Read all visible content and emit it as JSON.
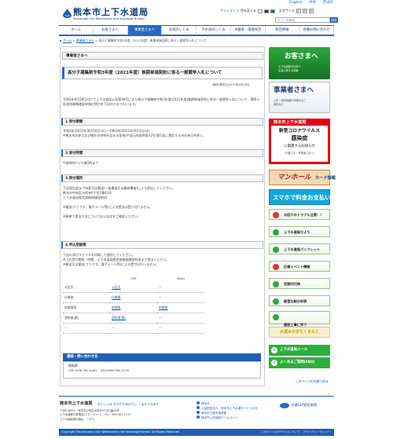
{
  "header": {
    "site_title": "熊本市上下水道局",
    "site_subtitle": "Kumamoto City Waterworks and Sewerage Bureau",
    "lang_links": [
      "English",
      "中文",
      "한국어"
    ],
    "sitemap_label": "サイトマップ",
    "color_label": "色を変える",
    "font_size_label": "文字サイズ",
    "font_size_buttons": [
      "小",
      "中",
      "大"
    ],
    "search_placeholder": "サイト内検索",
    "search_button": "検索",
    "accent_color": "#1f5eb5"
  },
  "nav": {
    "items": [
      "ホーム",
      "お客さまへ",
      "事業者さまへ",
      "水道のしくみ",
      "下水道のしくみ",
      "水循環・環境保全",
      "経営情報",
      "各種お問い合わせ"
    ],
    "active_index": 2
  },
  "breadcrumb": [
    "ホーム",
    "事業者さまへ",
    "高分子凝集剤令和3年度（2021年度）後期単価契約に係る一般競争入札について"
  ],
  "main": {
    "section_head": "事業者さまへ",
    "page_title": "高分子凝集剤令和3年度（2021年度）後期単価契約に係る一般競争入札について",
    "updated": "[最終更新日]2021年8月18日",
    "intro": "令和3年8月18日付けで上下水道局公告第38号により高分子凝集剤令和3年度(2021年度)後期単価契約に係る一般競争入札について、競争入札参加資格確認申請の受付を下記のとおり行います。",
    "sections": [
      {
        "title": "1.受付期間",
        "body": "令和3年(2021年)8月18日(水)～令和3年(2021年)9月1日(水)\n※熊本市の休日及び閉庁の特例を定める条例(平成元年条例第32号)第1条に規定する市の休日を除く。"
      },
      {
        "title": "2.受付時間",
        "body": "午前9時から午後5時まで"
      },
      {
        "title": "3.受付場所",
        "body": "下記宛先部まで持参又は郵送(一般書留又は簡易書留)により提出してください。\n熊本市中央区水前寺6丁目2番45号\n上下水道局経営部総務課契約班\n\n※電送(ファクス、電子メール等)による提出は受け付けません。\n\n※郵便で提出方法については公告文をご確認ください。"
      },
      {
        "title": "4.申込用紙等",
        "body": "下記の添付ファイルを印刷して使用してください。\n※上記受付期間・時間、上下水道局経営部総務課契約班まで提出ください。\n※郵送又は電送(ファクス、電子メール等)による受付は行いません。"
      }
    ],
    "table": {
      "headers": [
        "",
        "PDF",
        "Word"
      ],
      "rows": [
        [
          "公告文",
          "公告文",
          "－"
        ],
        [
          "仕様書",
          "仕様書",
          "－"
        ],
        [
          "申請書等",
          "申請書",
          "申請書"
        ],
        [
          "契約書(案)",
          "契約書(案)",
          "－"
        ],
        [
          "－",
          "－",
          "－"
        ]
      ]
    },
    "contact": {
      "head": "連絡・問い合わせ先",
      "dept": "総務課",
      "tel": "(TEL)096-381-4081　(FAX)096-384-4135"
    },
    "pagetop": "このページの先頭へ戻る"
  },
  "sidebar": {
    "okyaku_title": "お客さまへ",
    "okyaku_sub": "上下水道局の仕事や\n生活に関する情報",
    "jigyo_title": "事業者さまへ",
    "jigyo_sub": "入札・契約情報や手続きのご\n案内など",
    "covid": {
      "top": "熊本市上下水道局",
      "l1": "新型コロナウイルス",
      "l2": "感染症",
      "l3": "に関連するお知らせ",
      "l4": "（お客さま・事業者さまへ）"
    },
    "manhole": {
      "title": "マンホール",
      "sub": "カード情報"
    },
    "smartpay": "スマホで料金お支払い",
    "buttons": [
      {
        "label": "水回りのトラブル注意！！",
        "red": true
      },
      {
        "label": "上下水道局だより",
        "red": false
      },
      {
        "label": "上下水道局パンフレット",
        "red": false
      },
      {
        "label": "広報イベント情報",
        "red": true
      },
      {
        "label": "定期刊行物",
        "red": false
      },
      {
        "label": "経営比較分析表",
        "red": false
      },
      {
        "label": "建設工事に伴う\n水道水保全の事業",
        "red": false
      }
    ],
    "spray": "水道水のまちくまもと",
    "mail": "上下水道局メール",
    "faq": "よくあるご質問(FAQ)"
  },
  "footer": {
    "name": "熊本市上下水道局",
    "tagline": "おいしい水 かわやかみのたし くまもとのみず",
    "address": "〒862-8620　熊本市中央区水前寺6丁目2番45号\n上下水道局代表電話(マネージャー)　TEL：096-381-1131\n上下水道局案内図は　こちら",
    "links": [
      "熊本市",
      "公益財団法人　熊本市上下水道サービス公社",
      "熊本市立熊本図書館",
      "熊本市公共施設ホームページ"
    ],
    "glp": "水道GLP認定取得",
    "copyright": "Copyright ©Kumamoto City Waterworks and Sewerage Bureau. All Rights Reserved",
    "right_links": "このサイトのデザインについて　プライバシーポリシー"
  }
}
